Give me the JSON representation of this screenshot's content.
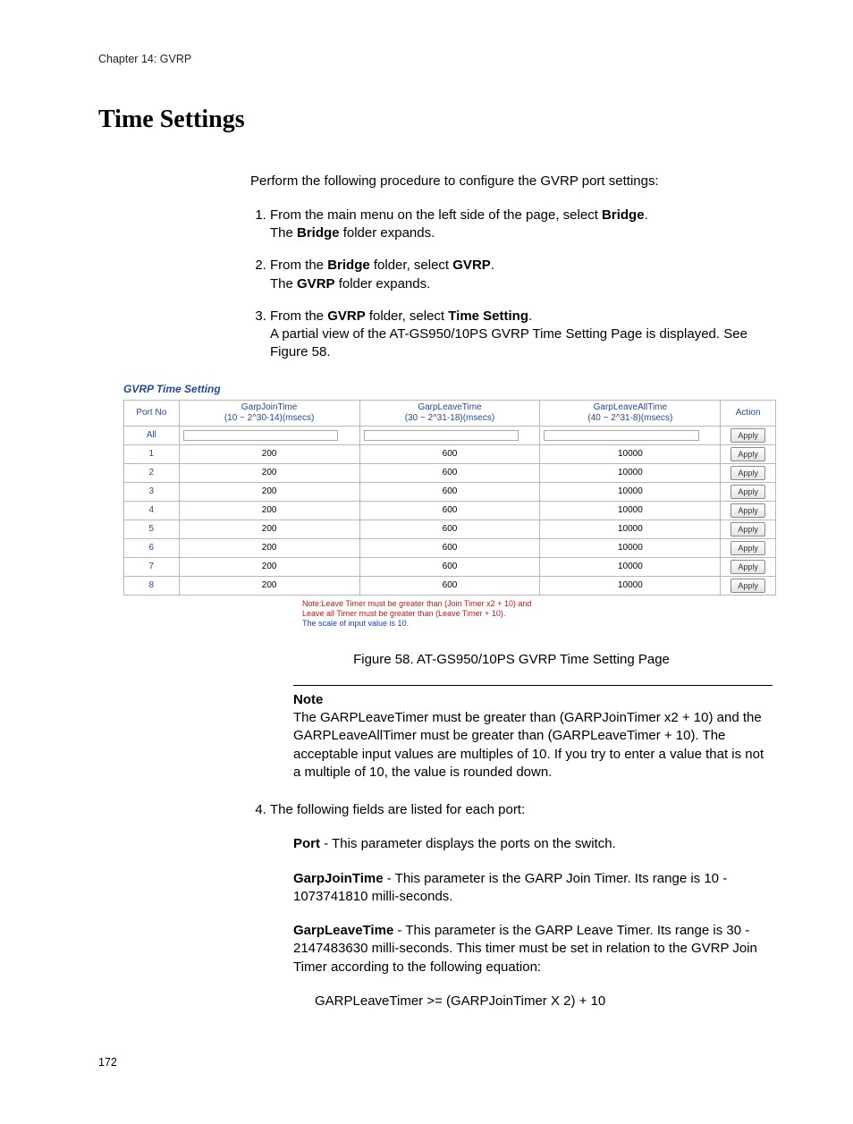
{
  "chapter_header": "Chapter 14: GVRP",
  "section_title": "Time Settings",
  "intro": "Perform the following procedure to configure the GVRP port settings:",
  "steps": {
    "s1a": "From the main menu on the left side of the page, select ",
    "s1b_bold": "Bridge",
    "s1c": ".",
    "s1d": "The ",
    "s1e_bold": "Bridge",
    "s1f": " folder expands.",
    "s2a": "From the ",
    "s2b_bold": "Bridge",
    "s2c": " folder, select ",
    "s2d_bold": "GVRP",
    "s2e": ".",
    "s2f": "The ",
    "s2g_bold": "GVRP",
    "s2h": " folder expands.",
    "s3a": "From the ",
    "s3b_bold": "GVRP",
    "s3c": " folder, select ",
    "s3d_bold": "Time Setting",
    "s3e": ".",
    "s3f": "A partial view of the AT-GS950/10PS GVRP Time Setting Page is displayed. See Figure 58.",
    "s4": "The following fields are listed for each port:"
  },
  "figure": {
    "title": "GVRP Time Setting",
    "headers": {
      "port": "Port No",
      "join_l1": "GarpJoinTime",
      "join_l2": "(10 ~ 2^30-14)(msecs)",
      "leave_l1": "GarpLeaveTime",
      "leave_l2": "(30 ~ 2^31-18)(msecs)",
      "all_l1": "GarpLeaveAllTime",
      "all_l2": "(40 ~ 2^31-8)(msecs)",
      "action": "Action"
    },
    "all_label": "All",
    "apply_label": "Apply",
    "rows": [
      {
        "port": "1",
        "join": "200",
        "leave": "600",
        "all": "10000"
      },
      {
        "port": "2",
        "join": "200",
        "leave": "600",
        "all": "10000"
      },
      {
        "port": "3",
        "join": "200",
        "leave": "600",
        "all": "10000"
      },
      {
        "port": "4",
        "join": "200",
        "leave": "600",
        "all": "10000"
      },
      {
        "port": "5",
        "join": "200",
        "leave": "600",
        "all": "10000"
      },
      {
        "port": "6",
        "join": "200",
        "leave": "600",
        "all": "10000"
      },
      {
        "port": "7",
        "join": "200",
        "leave": "600",
        "all": "10000"
      },
      {
        "port": "8",
        "join": "200",
        "leave": "600",
        "all": "10000"
      }
    ],
    "note_l1": "Note:Leave Timer must be greater than (Join Timer x2 + 10) and",
    "note_l2": "Leave all Timer must be greater than (Leave Timer + 10).",
    "note_l3": "The scale of input value is 10.",
    "caption": "Figure 58. AT-GS950/10PS GVRP Time Setting Page"
  },
  "note_block": {
    "label": "Note",
    "body": "The GARPLeaveTimer must be greater than (GARPJoinTimer x2 + 10) and the GARPLeaveAllTimer must be greater than (GARPLeaveTimer + 10). The acceptable input values are multiples of 10. If you try to enter a value that is not a multiple of 10, the value is rounded down."
  },
  "fields": {
    "port_term": "Port",
    "port_desc": " - This parameter displays the ports on the switch.",
    "join_term": "GarpJoinTime",
    "join_desc": " - This parameter is the GARP Join Timer. Its range is 10 - 1073741810 milli-seconds.",
    "leave_term": "GarpLeaveTime",
    "leave_desc": " - This parameter is the GARP Leave Timer. Its range is 30 - 2147483630 milli-seconds. This timer must be set in relation to the GVRP Join Timer according to the following equation:",
    "equation": "GARPLeaveTimer >= (GARPJoinTimer X 2) + 10"
  },
  "page_number": "172"
}
